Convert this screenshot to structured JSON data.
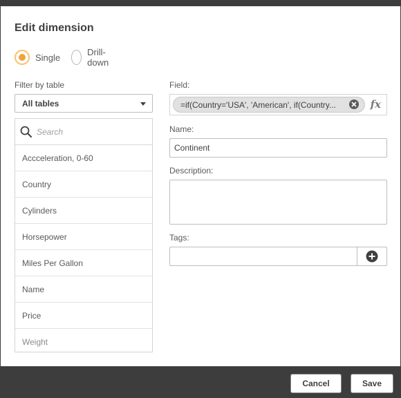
{
  "dialog": {
    "title": "Edit dimension"
  },
  "type_options": [
    {
      "label": "Single",
      "selected": true
    },
    {
      "label": "Drill-down",
      "selected": false
    }
  ],
  "filter": {
    "label": "Filter by table",
    "selected": "All tables"
  },
  "search": {
    "placeholder": "Search"
  },
  "fields": [
    "Accceleration, 0-60",
    "Country",
    "Cylinders",
    "Horsepower",
    "Miles Per Gallon",
    "Name",
    "Price",
    "Weight"
  ],
  "form": {
    "field_label": "Field:",
    "field_expression": "=if(Country='USA', 'American', if(Country...",
    "name_label": "Name:",
    "name_value": "Continent",
    "description_label": "Description:",
    "description_value": "",
    "tags_label": "Tags:",
    "tags_value": ""
  },
  "icons": {
    "radio_accent": "#f0a33a",
    "search": "search-icon",
    "clear": "clear-icon",
    "expression": "fx-icon",
    "add": "plus-circle-icon",
    "dropdown": "chevron-down-icon"
  },
  "footer": {
    "cancel_label": "Cancel",
    "save_label": "Save"
  }
}
